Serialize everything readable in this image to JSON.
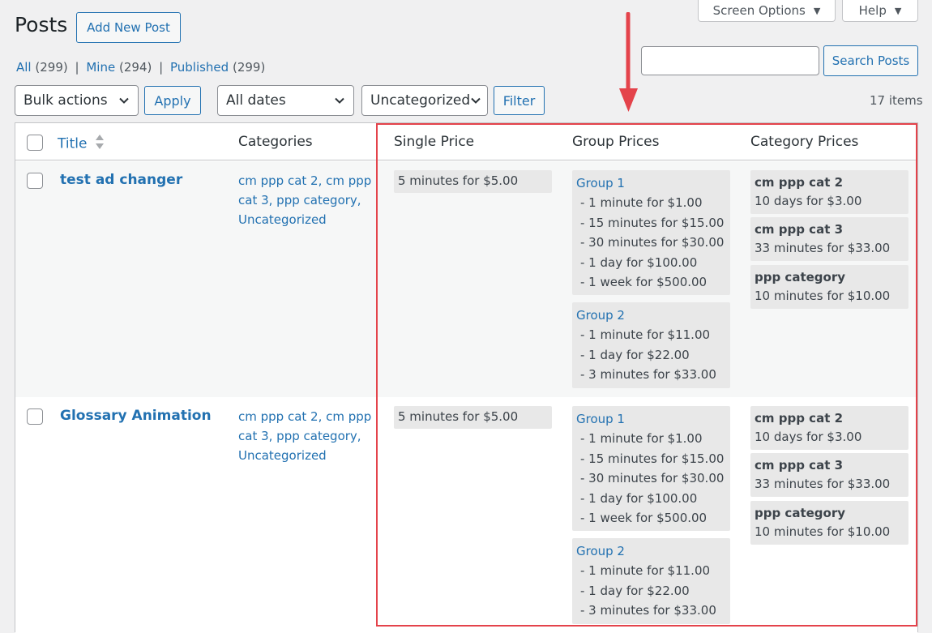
{
  "page": {
    "title": "Posts",
    "add_new_label": "Add New Post"
  },
  "tabs": {
    "screen_options": "Screen Options",
    "help": "Help"
  },
  "views": {
    "all_label": "All",
    "all_count": "(299)",
    "mine_label": "Mine",
    "mine_count": "(294)",
    "published_label": "Published",
    "published_count": "(299)",
    "separator": "|"
  },
  "search": {
    "value": "",
    "button_label": "Search Posts"
  },
  "filters": {
    "bulk_actions": "Bulk actions",
    "apply_label": "Apply",
    "dates": "All dates",
    "category": "Uncategorized",
    "filter_label": "Filter",
    "items_count": "17 items"
  },
  "table": {
    "columns": {
      "title": "Title",
      "categories": "Categories",
      "single_price": "Single Price",
      "group_prices": "Group Prices",
      "category_prices": "Category Prices"
    },
    "rows": [
      {
        "title": "test ad changer",
        "categories": [
          "cm ppp cat 2, cm ppp",
          "cat 3, ppp category,",
          "Uncategorized"
        ],
        "single_price": "5 minutes for $5.00",
        "groups": [
          {
            "name": "Group 1",
            "lines": [
              "- 1 minute for $1.00",
              "- 15 minutes for $15.00",
              "- 30 minutes for $30.00",
              "- 1 day for $100.00",
              "- 1 week for $500.00"
            ]
          },
          {
            "name": "Group 2",
            "lines": [
              "- 1 minute for $11.00",
              "- 1 day for $22.00",
              "- 3 minutes for $33.00"
            ]
          }
        ],
        "category_prices": [
          {
            "name": "cm ppp cat 2",
            "price": "10 days for $3.00"
          },
          {
            "name": "cm ppp cat 3",
            "price": "33 minutes for $33.00"
          },
          {
            "name": "ppp category",
            "price": "10 minutes for $10.00"
          }
        ]
      },
      {
        "title": "Glossary Animation",
        "categories": [
          "cm ppp cat 2, cm ppp",
          "cat 3, ppp category,",
          "Uncategorized"
        ],
        "single_price": "5 minutes for $5.00",
        "groups": [
          {
            "name": "Group 1",
            "lines": [
              "- 1 minute for $1.00",
              "- 15 minutes for $15.00",
              "- 30 minutes for $30.00",
              "- 1 day for $100.00",
              "- 1 week for $500.00"
            ]
          },
          {
            "name": "Group 2",
            "lines": [
              "- 1 minute for $11.00",
              "- 1 day for $22.00",
              "- 3 minutes for $33.00"
            ]
          }
        ],
        "category_prices": [
          {
            "name": "cm ppp cat 2",
            "price": "10 days for $3.00"
          },
          {
            "name": "cm ppp cat 3",
            "price": "33 minutes for $33.00"
          },
          {
            "name": "ppp category",
            "price": "10 minutes for $10.00"
          }
        ]
      }
    ]
  },
  "annotation": {
    "highlight_color": "#e4434b",
    "arrow_color": "#e4434b"
  }
}
